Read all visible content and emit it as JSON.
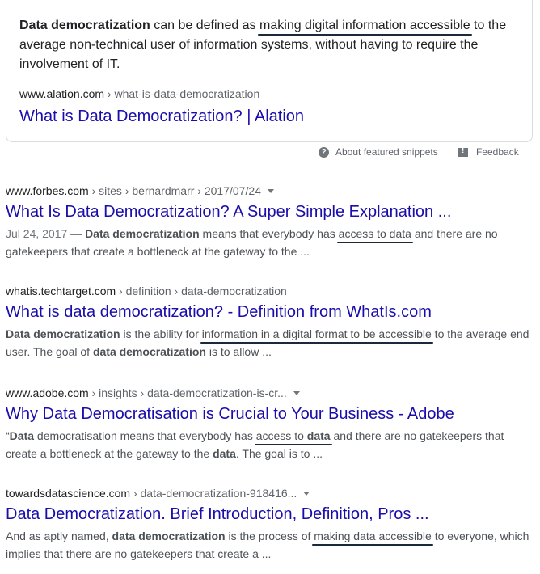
{
  "featured": {
    "text_bold": "Data democratization",
    "text_a": " can be defined as ",
    "text_highlight": "making digital information accessible",
    "text_b": " to the average non-technical user of information systems, without having to require the involvement of IT.",
    "cite_domain": "www.alation.com",
    "cite_path": " › what-is-data-democratization",
    "title": "What is Data Democratization? | Alation",
    "about_label": "About featured snippets",
    "feedback_label": "Feedback"
  },
  "results": [
    {
      "domain": "www.forbes.com",
      "path": " › sites › bernardmarr › 2017/07/24",
      "has_menu": true,
      "title": "What Is Data Democratization? A Super Simple Explanation ...",
      "date": "Jul 24, 2017 — ",
      "s1_bold": "Data democratization",
      "s2": " means that everybody has ",
      "s3_hl": "access to data",
      "s4": " and there are no gatekeepers that create a bottleneck at the gateway to the ..."
    },
    {
      "domain": "whatis.techtarget.com",
      "path": " › definition › data-democratization",
      "has_menu": false,
      "title": "What is data democratization? - Definition from WhatIs.com",
      "s1_bold": "Data democratization",
      "s2": " is the ability for ",
      "s3_hl": "information in a digital format to be accessible",
      "s4": " to the average end user. The goal of ",
      "s5_bold": "data democratization",
      "s6": " is to allow ..."
    },
    {
      "domain": "www.adobe.com",
      "path": " › insights › data-democratization-is-cr...",
      "has_menu": true,
      "title": "Why Data Democratisation is Crucial to Your Business - Adobe",
      "s0": "“",
      "s1_bold": "Data",
      "s2": " democratisation means that everybody has ",
      "s3_hl": "access to ",
      "s3_hl_bold": "data",
      "s4": " and there are no gatekeepers that create a bottleneck at the gateway to the ",
      "s5_bold": "data",
      "s6": ". The goal is to ..."
    },
    {
      "domain": "towardsdatascience.com",
      "path": " › data-democratization-918416...",
      "has_menu": true,
      "title": "Data Democratization. Brief Introduction, Definition, Pros ...",
      "s2": "And as aptly named, ",
      "s1_bold": "data democratization",
      "s4": " is the process of ",
      "s3_hl": "making data accessible",
      "s6": " to everyone, which implies that there are no gatekeepers that create a ..."
    }
  ],
  "colors": {
    "link": "#1a0dab",
    "snippet": "#4d5156",
    "underline": "#1a2a3a"
  }
}
